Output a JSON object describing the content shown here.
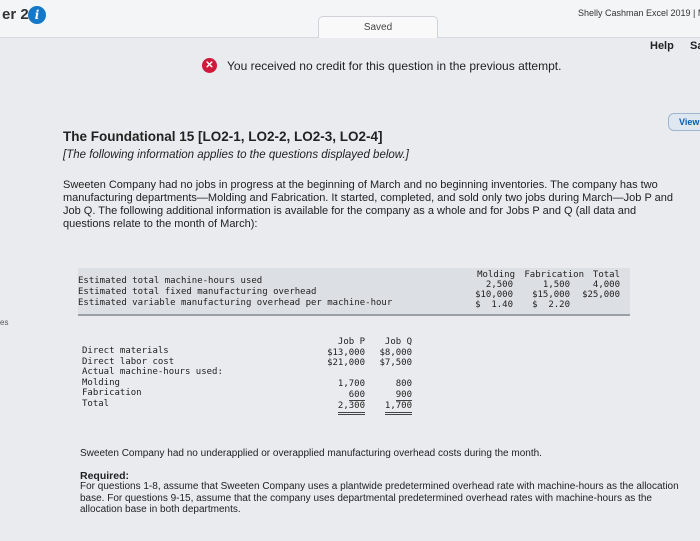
{
  "header": {
    "chapter_label": "er 2",
    "book_title": "Shelly Cashman Excel 2019 | M",
    "saved_label": "Saved",
    "help_label": "Help",
    "save_label": "Sa"
  },
  "notice": {
    "text": "You received no credit for this question in the previous attempt."
  },
  "side": {
    "view_label": "View",
    "left_label": "es"
  },
  "question": {
    "title": "The Foundational 15 [LO2-1, LO2-2, LO2-3, LO2-4]",
    "subtitle": "[The following information applies to the questions displayed below.]",
    "intro": "Sweeten Company had no jobs in progress at the beginning of March and no beginning inventories. The company has two manufacturing departments—Molding and Fabrication. It started, completed, and sold only two jobs during March—Job P and Job Q. The following additional information is available for the company as a whole and for Jobs P and Q (all data and questions relate to the month of March):",
    "no_under_text": "Sweeten Company had no underapplied or overapplied manufacturing overhead costs during the month.",
    "required_label": "Required:",
    "required_text": "For questions 1-8, assume that Sweeten Company uses a plantwide predetermined overhead rate with machine-hours as the allocation base. For questions 9-15, assume that the company uses departmental predetermined overhead rates with machine-hours as the allocation base in both departments."
  },
  "table1": {
    "headers": [
      "Molding",
      "Fabrication",
      "Total"
    ],
    "rows": [
      {
        "label": "Estimated total machine-hours used",
        "molding": "2,500",
        "fabrication": "1,500",
        "total": "4,000"
      },
      {
        "label": "Estimated total fixed manufacturing overhead",
        "molding": "$10,000",
        "fabrication": "$15,000",
        "total": "$25,000"
      },
      {
        "label": "Estimated variable manufacturing overhead per machine-hour",
        "molding": "$  1.40",
        "fabrication": "$  2.20",
        "total": ""
      }
    ]
  },
  "table2": {
    "headers": [
      "Job P",
      "Job Q"
    ],
    "labels": [
      "Direct materials",
      "Direct labor cost",
      "Actual machine-hours used:",
      "Molding",
      "Fabrication",
      "Total"
    ],
    "job_p": [
      "$13,000",
      "$21,000",
      "",
      "1,700",
      "600",
      "2,300"
    ],
    "job_q": [
      "$8,000",
      "$7,500",
      "",
      "800",
      "900",
      "1,700"
    ]
  }
}
